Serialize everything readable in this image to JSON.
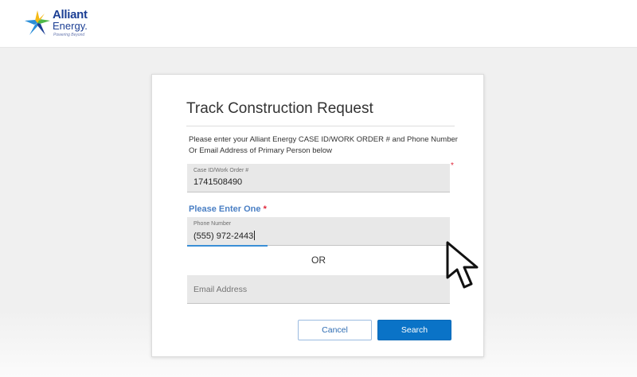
{
  "header": {
    "brand_line1": "Alliant",
    "brand_line2": "Energy.",
    "tagline": "Powering Beyond",
    "logo_colors": [
      "#f5b915",
      "#2a8ed8",
      "#1c3f94",
      "#4fb848"
    ]
  },
  "form": {
    "title": "Track Construction Request",
    "instructions": "Please enter your Alliant Energy CASE ID/WORK ORDER # and Phone Number Or Email Address of Primary Person below",
    "case_id": {
      "label": "Case ID/Work Order #",
      "value": "1741508490",
      "required_mark": "*"
    },
    "enter_one": {
      "label": "Please Enter One",
      "required_mark": "*"
    },
    "phone": {
      "label": "Phone Number",
      "value": "(555) 972-2443"
    },
    "or_text": "OR",
    "email": {
      "placeholder": "Email Address"
    },
    "cancel_label": "Cancel",
    "search_label": "Search"
  },
  "colors": {
    "primary_button": "#0a73c7",
    "accent_label": "#4a7fc4",
    "required": "#e0263a"
  }
}
